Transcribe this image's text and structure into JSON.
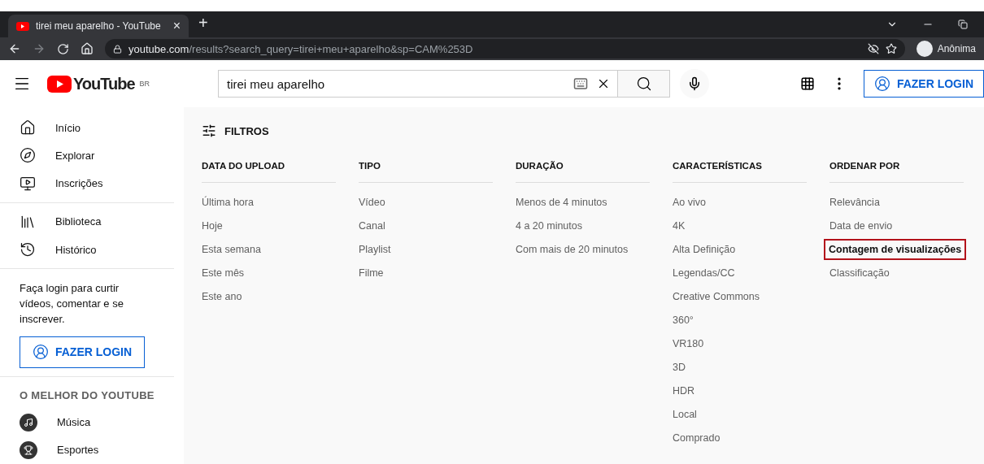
{
  "browser": {
    "tab": {
      "title": "tirei meu aparelho - YouTube",
      "close": "×"
    },
    "new_tab": "+",
    "address": {
      "host": "youtube.com",
      "path": "/results?search_query=tirei+meu+aparelho&sp=CAM%253D"
    },
    "profile": "Anônima"
  },
  "header": {
    "logo": "YouTube",
    "region": "BR",
    "search": {
      "value": "tirei meu aparelho"
    },
    "login": "FAZER LOGIN"
  },
  "sidebar": {
    "items": [
      {
        "label": "Início",
        "kind": "home"
      },
      {
        "label": "Explorar",
        "kind": "compass"
      },
      {
        "label": "Inscrições",
        "kind": "subs"
      }
    ],
    "library": [
      {
        "label": "Biblioteca",
        "kind": "library"
      },
      {
        "label": "Histórico",
        "kind": "history"
      }
    ],
    "login_prompt": "Faça login para curtir vídeos, comentar e se inscrever.",
    "login": "FAZER LOGIN",
    "section": "O MELHOR DO YOUTUBE",
    "best": [
      {
        "label": "Música",
        "kind": "music"
      },
      {
        "label": "Esportes",
        "kind": "trophy"
      }
    ]
  },
  "filters": {
    "title": "FILTROS",
    "columns": [
      {
        "heading": "DATA DO UPLOAD",
        "options": [
          {
            "label": "Última hora",
            "selected": false
          },
          {
            "label": "Hoje",
            "selected": false
          },
          {
            "label": "Esta semana",
            "selected": false
          },
          {
            "label": "Este mês",
            "selected": false
          },
          {
            "label": "Este ano",
            "selected": false
          }
        ]
      },
      {
        "heading": "TIPO",
        "options": [
          {
            "label": "Vídeo",
            "selected": false
          },
          {
            "label": "Canal",
            "selected": false
          },
          {
            "label": "Playlist",
            "selected": false
          },
          {
            "label": "Filme",
            "selected": false
          }
        ]
      },
      {
        "heading": "DURAÇÃO",
        "options": [
          {
            "label": "Menos de 4 minutos",
            "selected": false
          },
          {
            "label": "4 a 20 minutos",
            "selected": false
          },
          {
            "label": "Com mais de 20 minutos",
            "selected": false
          }
        ]
      },
      {
        "heading": "CARACTERÍSTICAS",
        "options": [
          {
            "label": "Ao vivo",
            "selected": false
          },
          {
            "label": "4K",
            "selected": false
          },
          {
            "label": "Alta Definição",
            "selected": false
          },
          {
            "label": "Legendas/CC",
            "selected": false
          },
          {
            "label": "Creative Commons",
            "selected": false
          },
          {
            "label": "360°",
            "selected": false
          },
          {
            "label": "VR180",
            "selected": false
          },
          {
            "label": "3D",
            "selected": false
          },
          {
            "label": "HDR",
            "selected": false
          },
          {
            "label": "Local",
            "selected": false
          },
          {
            "label": "Comprado",
            "selected": false
          }
        ]
      },
      {
        "heading": "ORDENAR POR",
        "options": [
          {
            "label": "Relevância",
            "selected": false
          },
          {
            "label": "Data de envio",
            "selected": false
          },
          {
            "label": "Contagem de visualizações",
            "selected": true
          },
          {
            "label": "Classificação",
            "selected": false
          }
        ]
      }
    ]
  }
}
